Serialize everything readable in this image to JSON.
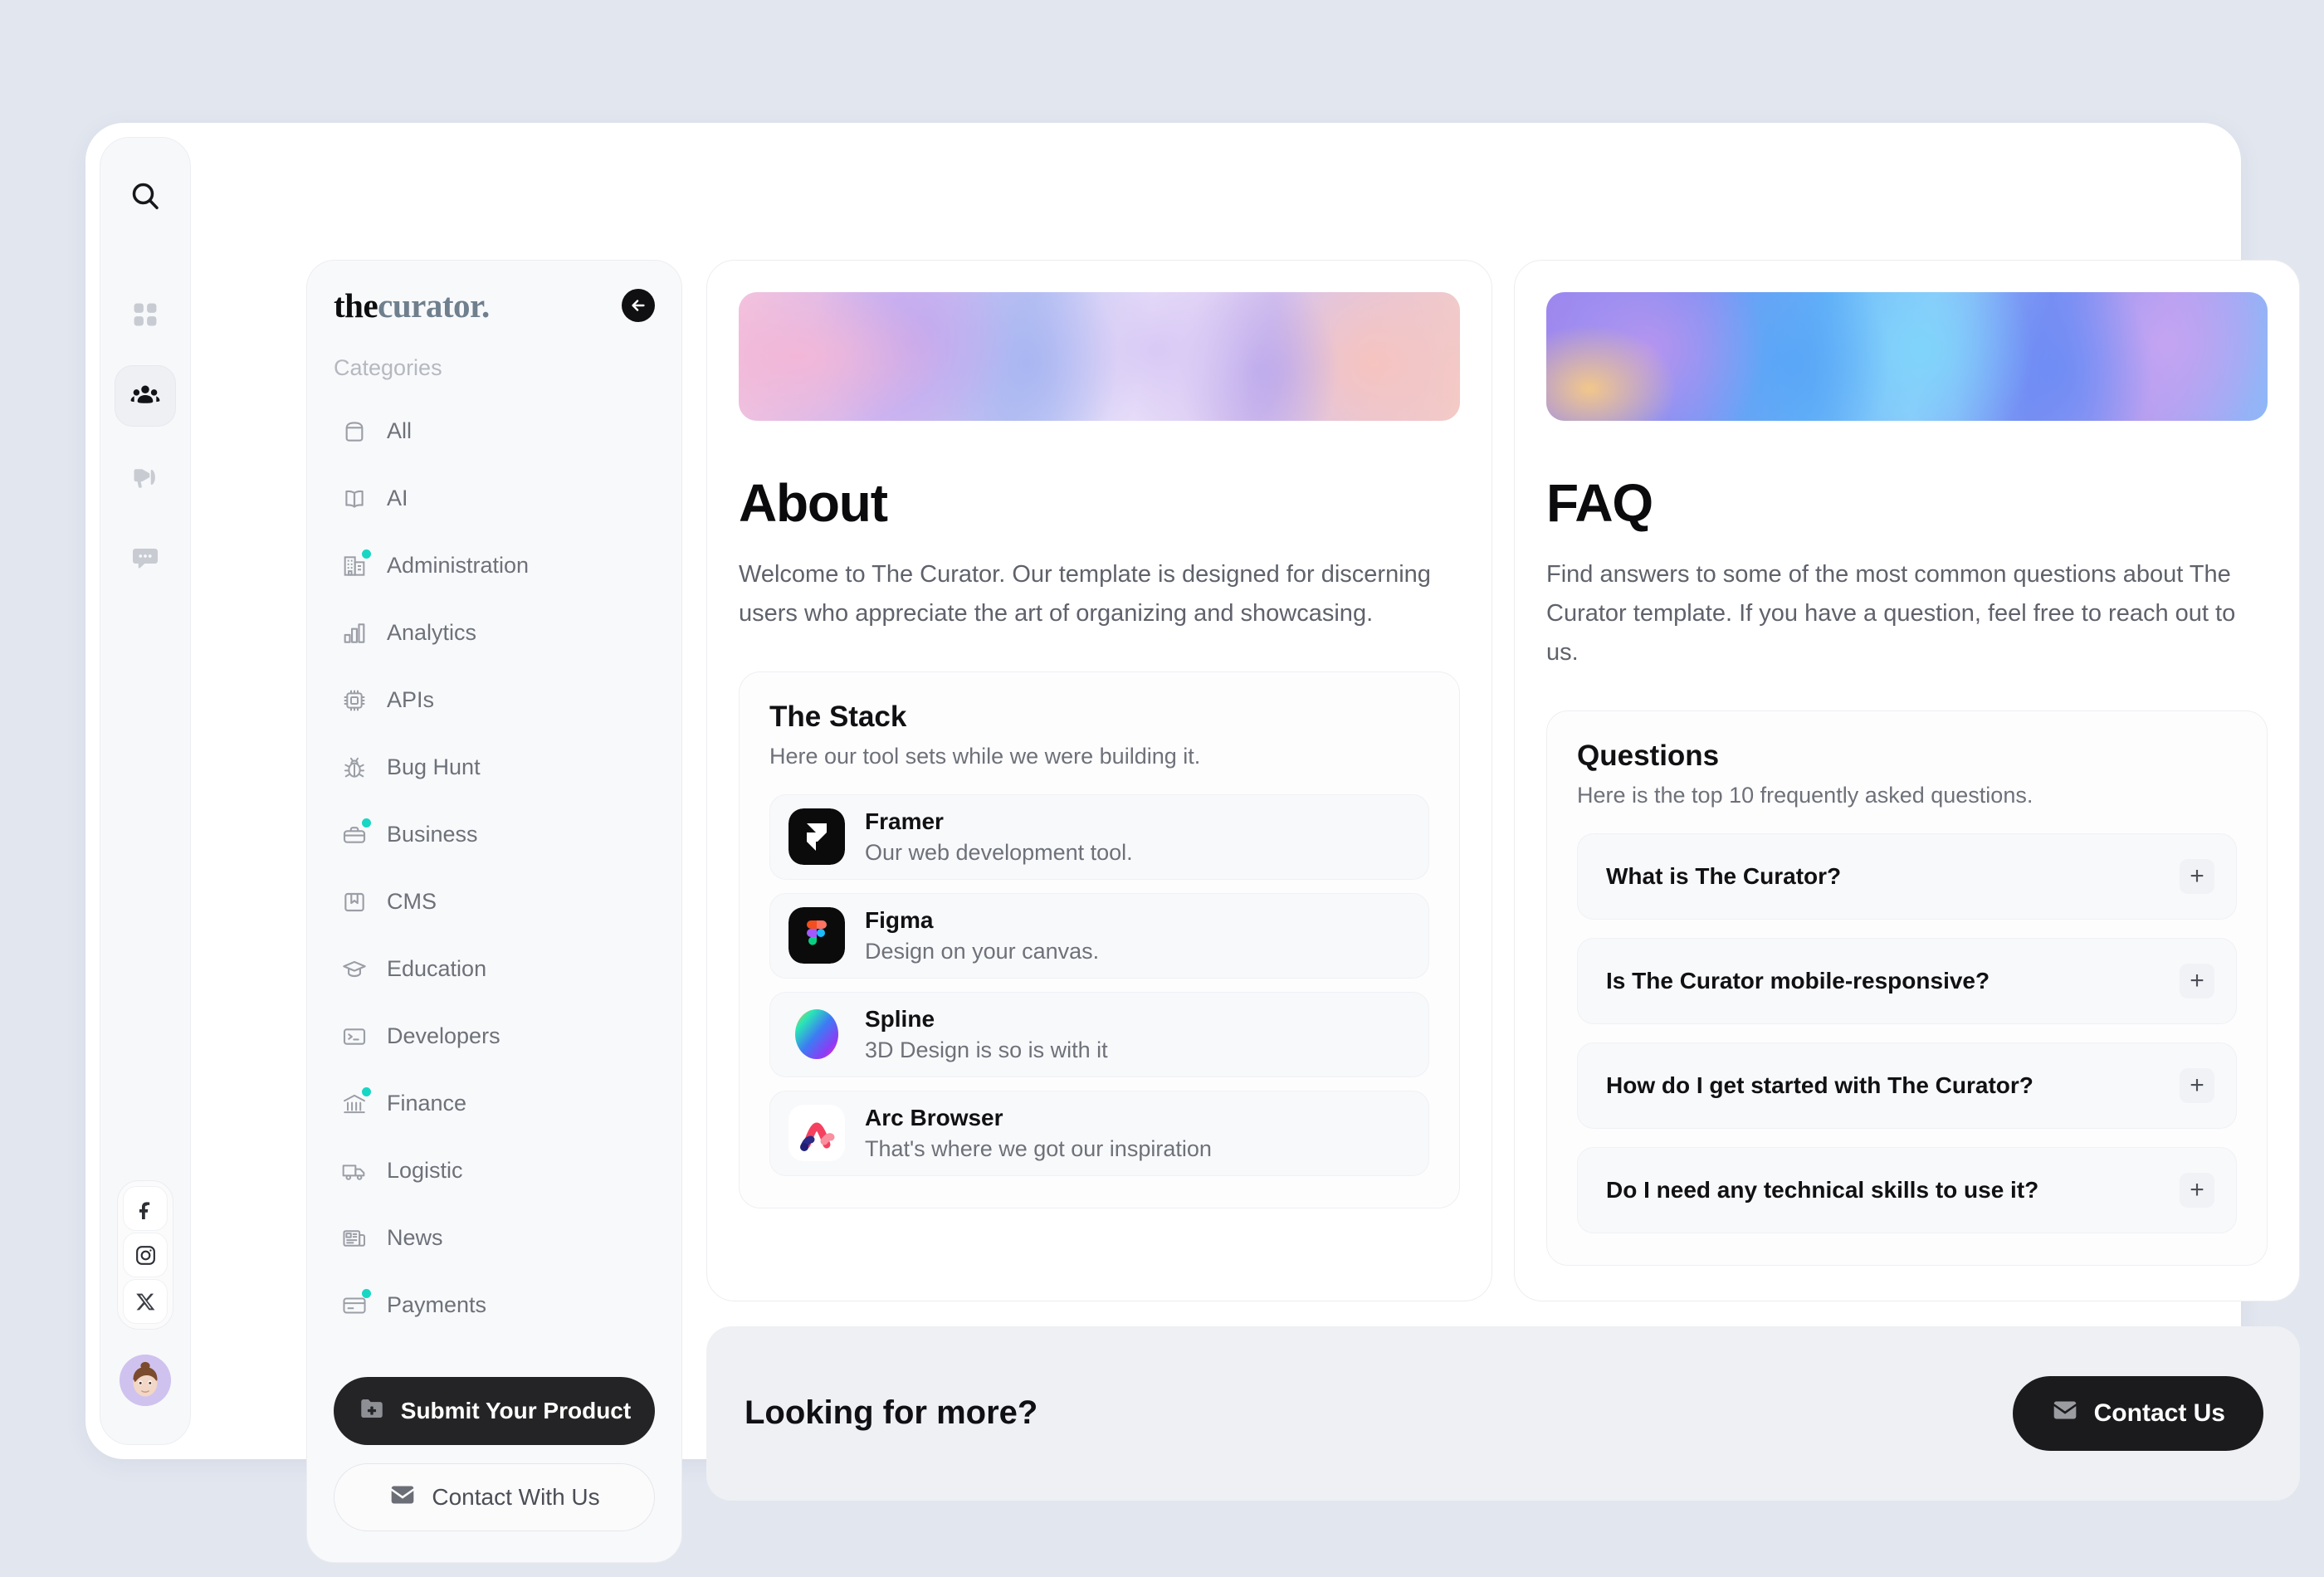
{
  "rail": {
    "search_icon": "search-icon",
    "nav": [
      {
        "icon": "grid-icon",
        "name": "grid",
        "active": false
      },
      {
        "icon": "community-icon",
        "name": "community",
        "active": true
      },
      {
        "icon": "megaphone-icon",
        "name": "announcements",
        "active": false
      },
      {
        "icon": "chat-icon",
        "name": "messages",
        "active": false
      }
    ],
    "social": [
      {
        "icon": "facebook-icon",
        "glyph": "f",
        "name": "facebook"
      },
      {
        "icon": "instagram-icon",
        "glyph": "◎",
        "name": "instagram"
      },
      {
        "icon": "x-twitter-icon",
        "glyph": "𝕏",
        "name": "x-twitter"
      }
    ],
    "avatar_label": "user-avatar"
  },
  "sidebar": {
    "logo": {
      "part1": "the",
      "part2": "curator."
    },
    "collapse_label": "←",
    "categories_title": "Categories",
    "items": [
      {
        "label": "All",
        "icon": "archive-box-icon",
        "badge": false
      },
      {
        "label": "AI",
        "icon": "open-book-icon",
        "badge": false
      },
      {
        "label": "Administration",
        "icon": "office-building-icon",
        "badge": true
      },
      {
        "label": "Analytics",
        "icon": "bar-chart-icon",
        "badge": false
      },
      {
        "label": "APIs",
        "icon": "chip-icon",
        "badge": false
      },
      {
        "label": "Bug Hunt",
        "icon": "bug-icon",
        "badge": false
      },
      {
        "label": "Business",
        "icon": "briefcase-icon",
        "badge": true
      },
      {
        "label": "CMS",
        "icon": "bookmark-icon",
        "badge": false
      },
      {
        "label": "Education",
        "icon": "graduation-cap-icon",
        "badge": false
      },
      {
        "label": "Developers",
        "icon": "terminal-icon",
        "badge": false
      },
      {
        "label": "Finance",
        "icon": "bank-icon",
        "badge": true
      },
      {
        "label": "Logistic",
        "icon": "truck-icon",
        "badge": false
      },
      {
        "label": "News",
        "icon": "newspaper-icon",
        "badge": false
      },
      {
        "label": "Payments",
        "icon": "credit-card-icon",
        "badge": true
      }
    ],
    "submit_button": "Submit Your Product",
    "submit_icon": "folder-plus-icon",
    "contact_button": "Contact With Us",
    "contact_icon": "envelope-icon"
  },
  "about_card": {
    "banner": "iridescent-pink-purple-banner",
    "title": "About",
    "description": "Welcome to The Curator. Our template is designed for discerning users who appreciate the art of organizing and showcasing.",
    "stack": {
      "title": "The Stack",
      "subtitle": "Here our tool sets while we were building it.",
      "items": [
        {
          "name": "Framer",
          "desc": "Our web development tool.",
          "logo": "framer-logo"
        },
        {
          "name": "Figma",
          "desc": "Design on your canvas.",
          "logo": "figma-logo"
        },
        {
          "name": "Spline",
          "desc": "3D Design is so is with it",
          "logo": "spline-logo"
        },
        {
          "name": "Arc Browser",
          "desc": "That's where we got our inspiration",
          "logo": "arc-logo"
        }
      ]
    }
  },
  "faq_card": {
    "banner": "iridescent-blue-purple-banner",
    "title": "FAQ",
    "description": "Find answers to some of the most common questions about The Curator template. If you have a question, feel free to reach out to us.",
    "questions_block": {
      "title": "Questions",
      "subtitle": "Here is the top 10 frequently asked questions.",
      "items": [
        {
          "question": "What is The Curator?",
          "toggle": "+"
        },
        {
          "question": "Is The Curator mobile-responsive?",
          "toggle": "+"
        },
        {
          "question": "How do I get started with The Curator?",
          "toggle": "+"
        },
        {
          "question": "Do I need any technical skills to use it?",
          "toggle": "+"
        }
      ]
    }
  },
  "footer_bar": {
    "title": "Looking for more?",
    "button": "Contact Us",
    "button_icon": "envelope-icon"
  },
  "colors": {
    "page_bg": "#e2e6ef",
    "accent_badge": "#18d6c4",
    "dark": "#1b1b1d",
    "muted_text": "#6e7179"
  }
}
